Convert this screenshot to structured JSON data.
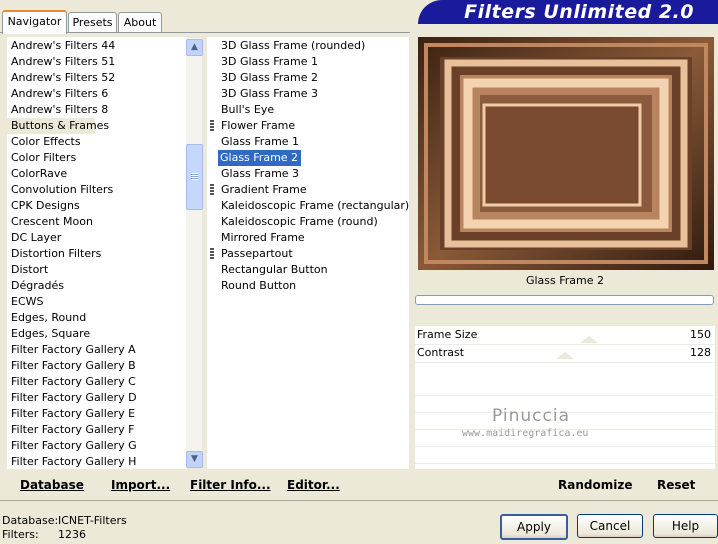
{
  "tabs": {
    "navigator": "Navigator",
    "presets": "Presets",
    "about": "About"
  },
  "banner": {
    "title": "Filters Unlimited 2.0"
  },
  "categories": [
    "Andrew's Filters 44",
    "Andrew's Filters 51",
    "Andrew's Filters 52",
    "Andrew's Filters 6",
    "Andrew's Filters 8",
    "Buttons & Frames",
    "Color Effects",
    "Color Filters",
    "ColorRave",
    "Convolution Filters",
    "CPK Designs",
    "Crescent Moon",
    "DC Layer",
    "Distortion Filters",
    "Distort",
    "Dégradés",
    "ECWS",
    "Edges, Round",
    "Edges, Square",
    "Filter Factory Gallery A",
    "Filter Factory Gallery B",
    "Filter Factory Gallery C",
    "Filter Factory Gallery D",
    "Filter Factory Gallery E",
    "Filter Factory Gallery F",
    "Filter Factory Gallery G",
    "Filter Factory Gallery H"
  ],
  "selected_category": "Buttons & Frames",
  "filters": [
    "3D Glass Frame (rounded)",
    "3D Glass Frame 1",
    "3D Glass Frame 2",
    "3D Glass Frame 3",
    "Bull's Eye",
    "Flower Frame",
    "Glass Frame 1",
    "Glass Frame 2",
    "Glass Frame 3",
    "Gradient Frame",
    "Kaleidoscopic Frame (rectangular)",
    "Kaleidoscopic Frame (round)",
    "Mirrored Frame",
    "Passepartout",
    "Rectangular Button",
    "Round Button"
  ],
  "selected_filter": "Glass Frame 2",
  "preview": {
    "filter_name": "Glass Frame 2",
    "watermark_name": "Pinuccia",
    "watermark_url": "www.maidiregrafica.eu"
  },
  "params": [
    {
      "label": "Frame Size",
      "value": "150"
    },
    {
      "label": "Contrast",
      "value": "128"
    }
  ],
  "links": {
    "database": "Database",
    "import": "Import...",
    "filter_info": "Filter Info...",
    "editor": "Editor...",
    "randomize": "Randomize",
    "reset": "Reset"
  },
  "status": {
    "database_label": "Database:",
    "database_value": "ICNET-Filters",
    "filters_label": "Filters:",
    "filters_value": "1236"
  },
  "buttons": {
    "apply": "Apply",
    "cancel": "Cancel",
    "help": "Help"
  },
  "colors": {
    "banner": "#1a1a9c",
    "selection": "#316ac5",
    "background": "#ece9d8"
  }
}
